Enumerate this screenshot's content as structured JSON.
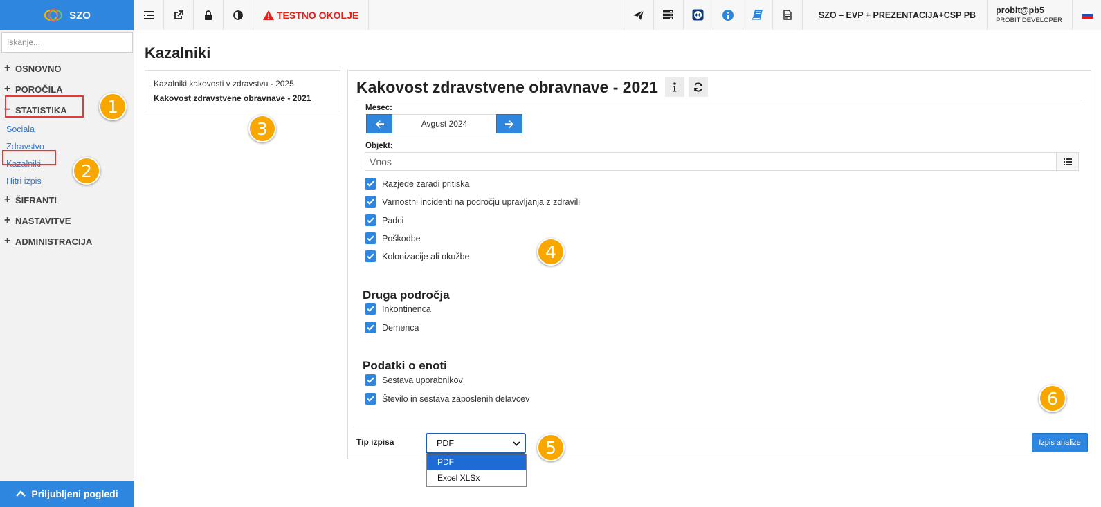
{
  "brand": {
    "name": "SZO"
  },
  "search": {
    "placeholder": "Iskanje..."
  },
  "sidebar": {
    "sections": [
      {
        "label": "OSNOVNO",
        "marker": "+"
      },
      {
        "label": "POROČILA",
        "marker": "+"
      },
      {
        "label": "STATISTIKA",
        "marker": "−"
      },
      {
        "label": "ŠIFRANTI",
        "marker": "+"
      },
      {
        "label": "NASTAVITVE",
        "marker": "+"
      },
      {
        "label": "ADMINISTRACIJA",
        "marker": "+"
      }
    ],
    "statistika_items": [
      "Sociala",
      "Zdravstvo",
      "Kazalniki",
      "Hitri izpis"
    ],
    "favorites_label": "Priljubljeni pogledi"
  },
  "topbar": {
    "test_env": "TESTNO OKOLJE",
    "org": "_SZO – EVP + PREZENTACIJA+CSP PB",
    "user": "probit@pb5",
    "role": "PROBIT DEVELOPER",
    "icons": [
      "list-icon",
      "external-link-icon",
      "lock-icon",
      "contrast-icon",
      "paper-plane-icon",
      "server-icon",
      "teamviewer-icon",
      "info-icon",
      "book-icon",
      "document-icon"
    ]
  },
  "page": {
    "title": "Kazalniki"
  },
  "reports": [
    "Kazalniki kakovosti v zdravstvu - 2025",
    "Kakovost zdravstvene obravnave - 2021"
  ],
  "form": {
    "title": "Kakovost zdravstvene obravnave - 2021",
    "month_label": "Mesec:",
    "month_value": "Avgust 2024",
    "object_label": "Objekt:",
    "object_placeholder": "Vnos",
    "main_items": [
      "Razjede zaradi pritiska",
      "Varnostni incidenti na področju upravljanja z zdravili",
      "Padci",
      "Poškodbe",
      "Kolonizacije ali okužbe"
    ],
    "other_title": "Druga področja",
    "other_items": [
      "Inkontinenca",
      "Demenca"
    ],
    "unit_title": "Podatki o enoti",
    "unit_items": [
      "Sestava uporabnikov",
      "Število in sestava zaposlenih delavcev"
    ],
    "output_label": "Tip izpisa",
    "output_value": "PDF",
    "output_options": [
      "PDF",
      "Excel XLSx"
    ],
    "submit_label": "Izpis analize"
  },
  "annotations": [
    "1",
    "2",
    "3",
    "4",
    "5",
    "6"
  ],
  "colors": {
    "primary": "#2e86de",
    "test_env": "#e8201a",
    "callout": "#f7a700",
    "highlight": "#e53935"
  }
}
